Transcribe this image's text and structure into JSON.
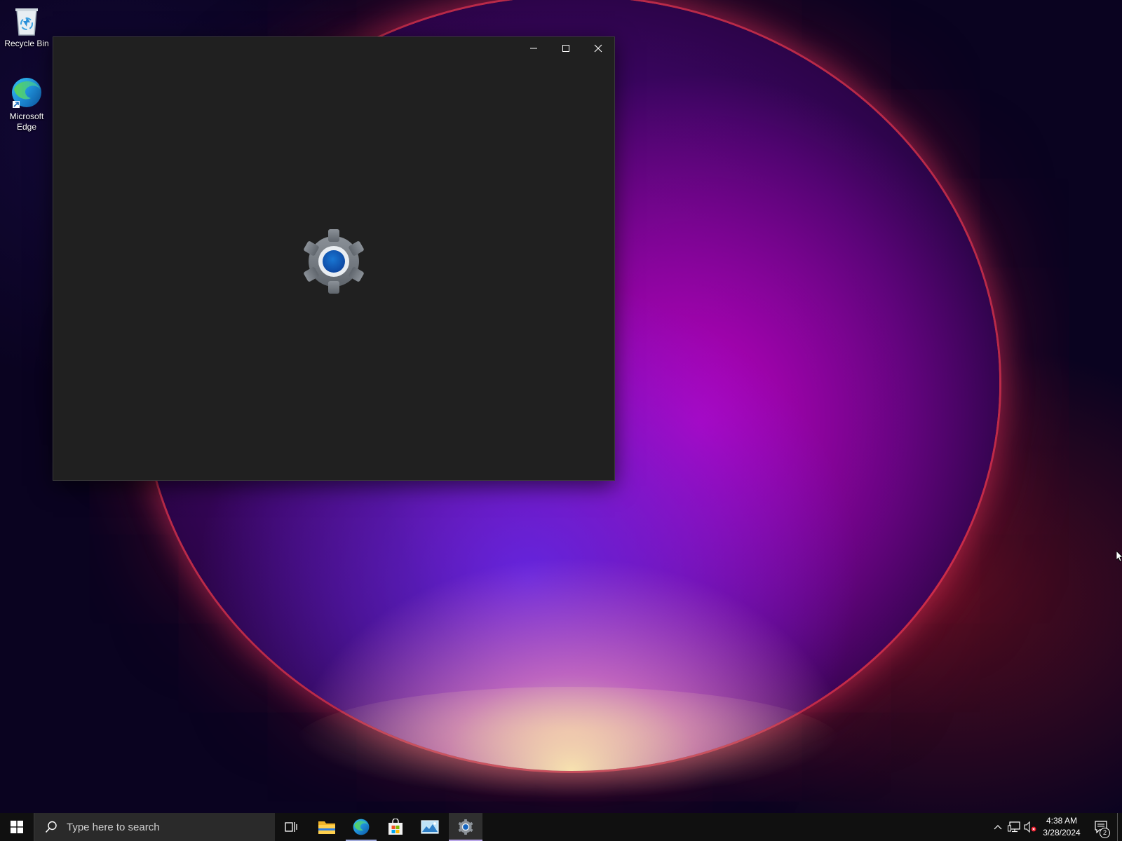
{
  "desktop": {
    "icons": [
      {
        "label": "Recycle Bin",
        "icon": "recycle-bin-icon"
      },
      {
        "label": "Microsoft Edge",
        "icon": "edge-icon"
      }
    ]
  },
  "window": {
    "app": "Settings",
    "state": "loading-splash",
    "splash_icon": "settings-gear-icon",
    "background_color": "#202020",
    "controls": [
      "minimize",
      "maximize",
      "close"
    ]
  },
  "taskbar": {
    "search": {
      "placeholder": "Type here to search"
    },
    "apps": [
      {
        "icon": "task-view-icon"
      },
      {
        "icon": "file-explorer-icon"
      },
      {
        "icon": "edge-icon",
        "running": true
      },
      {
        "icon": "microsoft-store-icon"
      },
      {
        "icon": "photos-icon"
      },
      {
        "icon": "settings-icon",
        "active": true
      }
    ],
    "tray": {
      "icons": [
        "show-hidden-icons-chevron",
        "network-icon",
        "volume-muted-icon"
      ],
      "time": "4:38 AM",
      "date": "3/28/2024",
      "notification_count": "2"
    }
  },
  "colors": {
    "taskbar": "#101010",
    "window": "#202020",
    "accent": "#1565c0"
  }
}
